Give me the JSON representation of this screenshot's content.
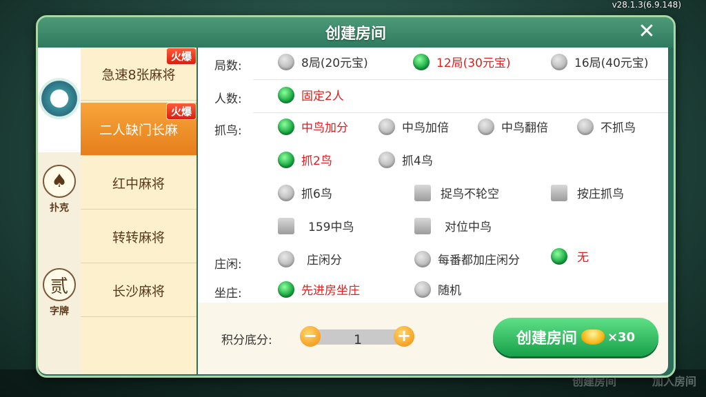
{
  "version": "v28.1.3(6.9.148)",
  "background_nav": [
    "创建房间",
    "加入房间"
  ],
  "dialog": {
    "title": "创建房间",
    "close_glyph": "✕",
    "categories": [
      {
        "icon": "mahjong-flower-icon",
        "label": ""
      },
      {
        "icon": "spade-icon",
        "glyph": "♠",
        "label": "扑克"
      },
      {
        "icon": "zipai-icon",
        "glyph": "贰",
        "label": "字牌"
      }
    ],
    "games": [
      {
        "label": "急速8张麻将",
        "badge": "火爆"
      },
      {
        "label": "二人缺门长麻",
        "badge": "火爆"
      },
      {
        "label": "红中麻将",
        "badge": ""
      },
      {
        "label": "转转麻将",
        "badge": ""
      },
      {
        "label": "长沙麻将",
        "badge": ""
      }
    ],
    "rows": {
      "rounds": {
        "label": "局数:",
        "options": [
          "8局(20元宝)",
          "12局(30元宝)",
          "16局(40元宝)"
        ],
        "selected": 1
      },
      "players": {
        "label": "人数:",
        "options": [
          "固定2人"
        ],
        "selected": 0
      },
      "birds": {
        "label": "抓鸟:",
        "scoring": [
          "中鸟加分",
          "中鸟加倍",
          "中鸟翻倍",
          "不抓鸟"
        ],
        "scoring_selected": 0,
        "count": [
          "抓2鸟",
          "抓4鸟",
          "抓6鸟"
        ],
        "count_selected": 0,
        "extras": [
          "捉鸟不轮空",
          "按庄抓鸟",
          "159中鸟",
          "对位中鸟"
        ]
      },
      "banker": {
        "label": "庄闲:",
        "options": [
          "庄闲分",
          "每番都加庄闲分",
          "无"
        ],
        "selected": 2
      },
      "seat": {
        "label": "坐庄:",
        "options": [
          "先进房坐庄",
          "随机"
        ],
        "selected": 0
      }
    },
    "footer": {
      "score_label": "积分底分:",
      "score_value": "1",
      "minus": "−",
      "plus": "+",
      "create_label": "创建房间",
      "cost": "×30"
    }
  }
}
